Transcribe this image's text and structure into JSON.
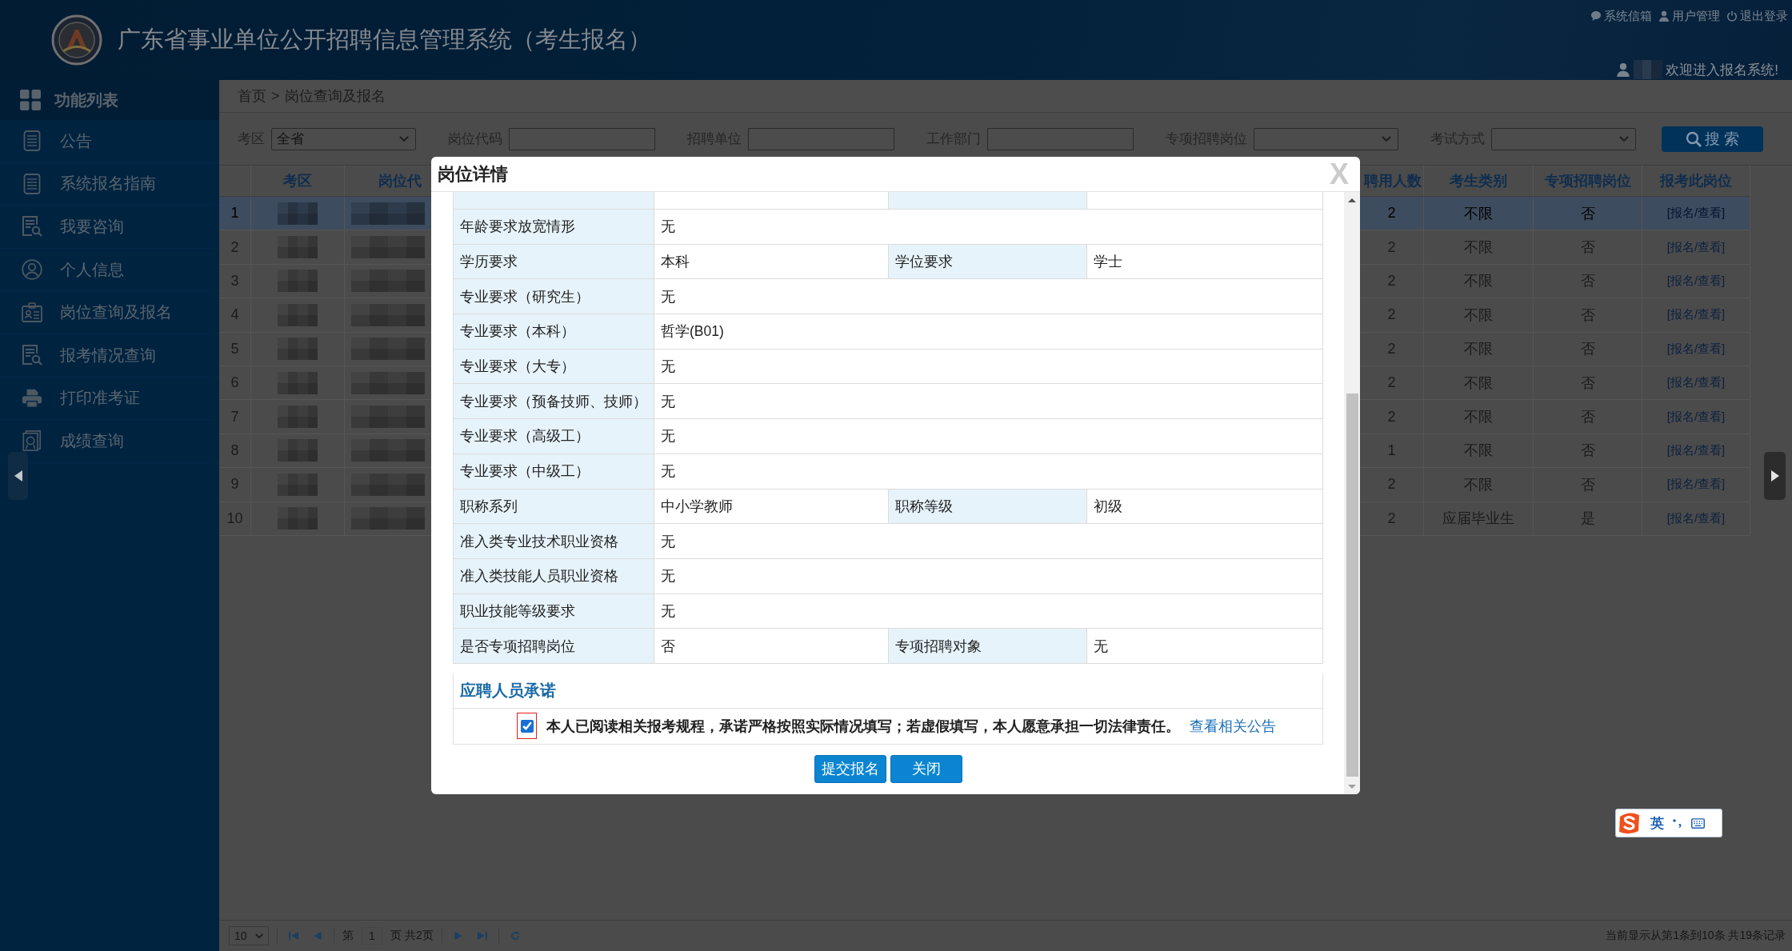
{
  "header": {
    "title": "广东省事业单位公开招聘信息管理系统（考生报名）",
    "links": [
      {
        "kind": "mailbox",
        "label": "系统信箱"
      },
      {
        "kind": "user",
        "label": "用户管理"
      },
      {
        "kind": "logout",
        "label": "退出登录"
      }
    ],
    "welcome": "欢迎进入报名系统!"
  },
  "sidebar": {
    "title": "功能列表",
    "items": [
      {
        "kind": "document",
        "label": "公告",
        "selected": false
      },
      {
        "kind": "document",
        "label": "系统报名指南",
        "selected": false
      },
      {
        "kind": "search",
        "label": "我要咨询",
        "selected": false
      },
      {
        "kind": "profile",
        "label": "个人信息",
        "selected": false
      },
      {
        "kind": "badge",
        "label": "岗位查询及报名",
        "selected": false
      },
      {
        "kind": "search",
        "label": "报考情况查询",
        "selected": false
      },
      {
        "kind": "printer",
        "label": "打印准考证",
        "selected": false
      },
      {
        "kind": "certificate",
        "label": "成绩查询",
        "selected": false
      }
    ]
  },
  "breadcrumb": {
    "items": [
      "首页",
      "岗位查询及报名"
    ],
    "separator": ">"
  },
  "filters": [
    {
      "kind": "select",
      "label": "考区",
      "value": "全省"
    },
    {
      "kind": "input",
      "label": "岗位代码"
    },
    {
      "kind": "input",
      "label": "招聘单位"
    },
    {
      "kind": "input",
      "label": "工作部门"
    },
    {
      "kind": "select",
      "label": "专项招聘岗位"
    },
    {
      "kind": "select",
      "label": "考试方式"
    }
  ],
  "search_button": "搜 索",
  "table": {
    "columns": [
      "考区",
      "岗位代",
      "聘用人数",
      "考生类别",
      "专项招聘岗位",
      "报考此岗位"
    ],
    "rows": [
      {
        "index": "1",
        "selected": true,
        "hires": "2",
        "candidate_type": "不限",
        "special_post": "否",
        "action": "[报名/查看]"
      },
      {
        "index": "2",
        "selected": false,
        "hires": "2",
        "candidate_type": "不限",
        "special_post": "否",
        "action": "[报名/查看]"
      },
      {
        "index": "3",
        "selected": false,
        "hires": "2",
        "candidate_type": "不限",
        "special_post": "否",
        "action": "[报名/查看]"
      },
      {
        "index": "4",
        "selected": false,
        "hires": "2",
        "candidate_type": "不限",
        "special_post": "否",
        "action": "[报名/查看]"
      },
      {
        "index": "5",
        "selected": false,
        "hires": "2",
        "candidate_type": "不限",
        "special_post": "否",
        "action": "[报名/查看]"
      },
      {
        "index": "6",
        "selected": false,
        "hires": "2",
        "candidate_type": "不限",
        "special_post": "否",
        "action": "[报名/查看]"
      },
      {
        "index": "7",
        "selected": false,
        "hires": "2",
        "candidate_type": "不限",
        "special_post": "否",
        "action": "[报名/查看]"
      },
      {
        "index": "8",
        "selected": false,
        "hires": "1",
        "candidate_type": "不限",
        "special_post": "否",
        "action": "[报名/查看]"
      },
      {
        "index": "9",
        "selected": false,
        "hires": "2",
        "candidate_type": "不限",
        "special_post": "否",
        "action": "[报名/查看]"
      },
      {
        "index": "10",
        "selected": false,
        "hires": "2",
        "candidate_type": "应届毕业生",
        "special_post": "是",
        "action": "[报名/查看]"
      }
    ]
  },
  "pager": {
    "page_size": "10",
    "page_prefix": "第",
    "page": "1",
    "page_suffix": "页 共2页",
    "summary": "当前显示从第1条到10条 共19条记录"
  },
  "dialog": {
    "title": "岗位详情",
    "close": "X",
    "details": [
      {
        "label": "年龄要求放宽情形",
        "value": "无"
      },
      {
        "label": "学历要求",
        "value": "本科",
        "label_2": "学位要求",
        "value_2": "学士"
      },
      {
        "label": "专业要求（研究生）",
        "value": "无"
      },
      {
        "label": "专业要求（本科）",
        "value": "哲学(B01)"
      },
      {
        "label": "专业要求（大专）",
        "value": "无"
      },
      {
        "label": "专业要求（预备技师、技师）",
        "value": "无"
      },
      {
        "label": "专业要求（高级工）",
        "value": "无"
      },
      {
        "label": "专业要求（中级工）",
        "value": "无"
      },
      {
        "label": "职称系列",
        "value": "中小学教师",
        "label_2": "职称等级",
        "value_2": "初级"
      },
      {
        "label": "准入类专业技术职业资格",
        "value": "无"
      },
      {
        "label": "准入类技能人员职业资格",
        "value": "无"
      },
      {
        "label": "职业技能等级要求",
        "value": "无"
      },
      {
        "label": "是否专项招聘岗位",
        "value": "否",
        "label_2": "专项招聘对象",
        "value_2": "无"
      }
    ],
    "pledge": {
      "heading": "应聘人员承诺",
      "checked": true,
      "highlighted": true,
      "text": "本人已阅读相关报考规程，承诺严格按照实际情况填写；若虚假填写，本人愿意承担一切法律责任。",
      "link": "查看相关公告"
    },
    "buttons": [
      "提交报名",
      "关闭"
    ]
  },
  "ime": {
    "mode": "英"
  }
}
